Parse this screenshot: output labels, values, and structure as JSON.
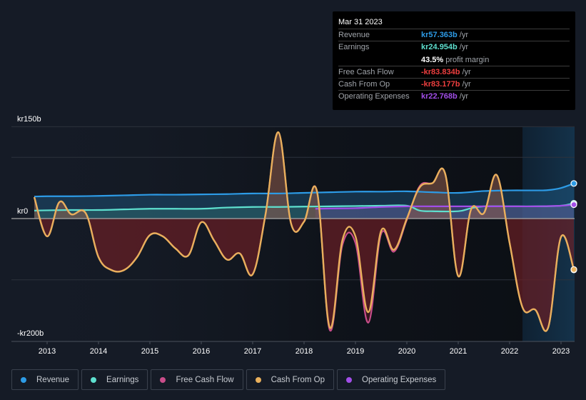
{
  "tooltip": {
    "date": "Mar 31 2023",
    "rows": [
      {
        "label": "Revenue",
        "value": "kr57.363b",
        "unit": "/yr",
        "color": "#2d9be6"
      },
      {
        "label": "Earnings",
        "value": "kr24.954b",
        "unit": "/yr",
        "color": "#5ee0cf"
      },
      {
        "label": "",
        "value": "43.5%",
        "unit": "profit margin",
        "color": "#ffffff"
      },
      {
        "label": "Free Cash Flow",
        "value": "-kr83.834b",
        "unit": "/yr",
        "color": "#ee3f3f"
      },
      {
        "label": "Cash From Op",
        "value": "-kr83.177b",
        "unit": "/yr",
        "color": "#ee3f3f"
      },
      {
        "label": "Operating Expenses",
        "value": "kr22.768b",
        "unit": "/yr",
        "color": "#a24ee8"
      }
    ]
  },
  "legend": [
    {
      "label": "Revenue",
      "color": "#2d9be6"
    },
    {
      "label": "Earnings",
      "color": "#5ee0cf"
    },
    {
      "label": "Free Cash Flow",
      "color": "#c94d8a"
    },
    {
      "label": "Cash From Op",
      "color": "#e9b05c"
    },
    {
      "label": "Operating Expenses",
      "color": "#a24ee8"
    }
  ],
  "chart_data": {
    "type": "line",
    "title": "",
    "xlabel": "",
    "ylabel": "",
    "y_tick_labels": [
      "kr150b",
      "kr0",
      "-kr200b"
    ],
    "y_ticks": [
      150,
      0,
      -200
    ],
    "ylim": [
      -200,
      150
    ],
    "xlim": [
      2012.3,
      2023.25
    ],
    "x_tick_labels": [
      "2013",
      "2014",
      "2015",
      "2016",
      "2017",
      "2018",
      "2019",
      "2020",
      "2021",
      "2022",
      "2023"
    ],
    "x_ticks": [
      2013,
      2014,
      2015,
      2016,
      2017,
      2018,
      2019,
      2020,
      2021,
      2022,
      2023
    ],
    "grid": true,
    "forecast_highlight_start": 2022.25,
    "legend_position": "bottom",
    "series": [
      {
        "name": "Revenue",
        "color": "#2d9be6",
        "x": [
          2012.75,
          2013,
          2013.5,
          2014,
          2014.5,
          2015,
          2015.5,
          2016,
          2016.5,
          2017,
          2017.5,
          2018,
          2018.5,
          2019,
          2019.5,
          2020,
          2020.5,
          2021,
          2021.5,
          2022,
          2022.5,
          2022.75,
          2023,
          2023.25
        ],
        "values": [
          36,
          36.5,
          36.5,
          37,
          38,
          39,
          39,
          39.5,
          40,
          41,
          41,
          42,
          43,
          44,
          44,
          44.5,
          43,
          42,
          45,
          46,
          46,
          46.5,
          50,
          57.363
        ]
      },
      {
        "name": "Earnings",
        "color": "#5ee0cf",
        "x": [
          2012.75,
          2013,
          2013.5,
          2014,
          2014.5,
          2015,
          2015.5,
          2016,
          2016.5,
          2017,
          2017.5,
          2018,
          2018.5,
          2019,
          2019.5,
          2020,
          2020.25,
          2020.5,
          2021,
          2021.25,
          2021.5,
          2022,
          2022.5,
          2023,
          2023.25
        ],
        "values": [
          13,
          13.5,
          14,
          14,
          15,
          16,
          16,
          16,
          18,
          19,
          19,
          19.5,
          20,
          20.5,
          21,
          21,
          13,
          12,
          12,
          17,
          20,
          20,
          20,
          21,
          24.954
        ]
      },
      {
        "name": "Free Cash Flow",
        "color": "#c94d8a",
        "x": [
          2012.75,
          2013,
          2013.24,
          2013.47,
          2013.75,
          2014,
          2014.25,
          2014.5,
          2014.75,
          2015,
          2015.25,
          2015.5,
          2015.75,
          2016,
          2016.25,
          2016.5,
          2016.75,
          2017,
          2017.25,
          2017.5,
          2017.75,
          2018,
          2018.25,
          2018.5,
          2018.75,
          2019,
          2019.25,
          2019.5,
          2019.75,
          2020,
          2020.25,
          2020.5,
          2020.75,
          2021,
          2021.25,
          2021.5,
          2021.75,
          2022,
          2022.25,
          2022.5,
          2022.75,
          2023,
          2023.25
        ],
        "values": [
          35,
          -29,
          27,
          7,
          9,
          -63,
          -84,
          -84,
          -63,
          -27,
          -29,
          -49,
          -60,
          -6,
          -36,
          -67,
          -57,
          -91,
          7,
          141,
          -9,
          -5,
          45,
          -182,
          -42,
          -40,
          -170,
          -25,
          -54,
          -2,
          53,
          58,
          72,
          -94,
          15,
          9,
          71,
          -40,
          -145,
          -149,
          -178,
          -30,
          -83.834
        ]
      },
      {
        "name": "Cash From Op",
        "color": "#e9b05c",
        "x": [
          2012.75,
          2013,
          2013.24,
          2013.47,
          2013.75,
          2014,
          2014.25,
          2014.5,
          2014.75,
          2015,
          2015.25,
          2015.5,
          2015.75,
          2016,
          2016.25,
          2016.5,
          2016.75,
          2017,
          2017.25,
          2017.5,
          2017.75,
          2018,
          2018.25,
          2018.5,
          2018.75,
          2019,
          2019.25,
          2019.5,
          2019.75,
          2020,
          2020.25,
          2020.5,
          2020.75,
          2021,
          2021.25,
          2021.5,
          2021.75,
          2022,
          2022.25,
          2022.5,
          2022.75,
          2023,
          2023.25
        ],
        "values": [
          35,
          -29,
          27,
          7,
          9,
          -63,
          -84,
          -84,
          -63,
          -27,
          -29,
          -49,
          -60,
          -6,
          -36,
          -67,
          -57,
          -91,
          7,
          141,
          -9,
          -5,
          45,
          -178,
          -34,
          -29,
          -153,
          -20,
          -51,
          0,
          51,
          58,
          72,
          -94,
          15,
          9,
          71,
          -40,
          -145,
          -149,
          -178,
          -30,
          -83.177
        ]
      },
      {
        "name": "Operating Expenses",
        "color": "#a24ee8",
        "x": [
          2018.22,
          2018.5,
          2019,
          2019.5,
          2020,
          2020.5,
          2021,
          2021.5,
          2022,
          2022.5,
          2023,
          2023.25
        ],
        "values": [
          16,
          16.5,
          17,
          19,
          20,
          20,
          20,
          20,
          20,
          20,
          21,
          22.768
        ]
      }
    ]
  }
}
